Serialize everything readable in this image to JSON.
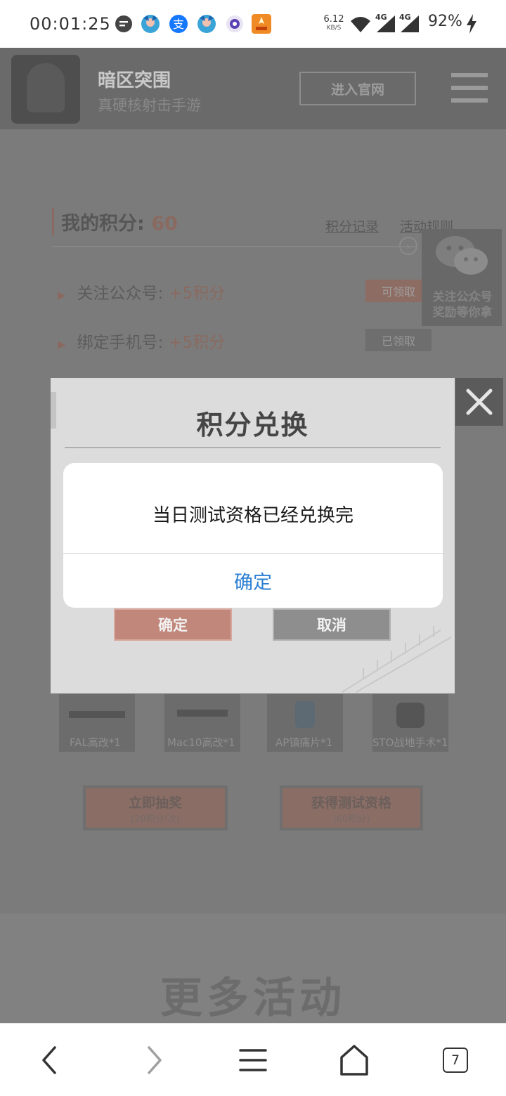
{
  "status_bar": {
    "time": "00:01:25",
    "net_speed_value": "6.12",
    "net_speed_unit": "KB/S",
    "signal_1": "4G",
    "signal_2": "4G",
    "battery": "92%"
  },
  "header": {
    "game_title": "暗区突围",
    "game_subtitle": "真硬核射击手游",
    "official_site_label": "进入官网"
  },
  "points": {
    "label": "我的积分:",
    "value": "60",
    "record_link": "积分记录",
    "rules_link": "活动规则"
  },
  "tasks": [
    {
      "label": "关注公众号:",
      "reward": "+5积分",
      "button": "可领取"
    },
    {
      "label": "绑定手机号:",
      "reward": "+5积分",
      "button": "已领取"
    }
  ],
  "wechat_float": {
    "line1": "关注公众号",
    "line2": "奖励等你拿"
  },
  "prizes": [
    {
      "label": "FAL高改*1"
    },
    {
      "label": "Mac10高改*1"
    },
    {
      "label": "AP镇痛片*1"
    },
    {
      "label": "STO战地手术*1"
    }
  ],
  "actions": {
    "draw": {
      "title": "立即抽奖",
      "sub": "(20积分/次)"
    },
    "qualify": {
      "title": "获得测试资格",
      "sub": "(60积分)"
    }
  },
  "more_activities": "更多活动",
  "modal": {
    "title": "积分兑换",
    "ok_label": "确定",
    "cancel_label": "取消"
  },
  "alert": {
    "message": "当日测试资格已经兑换完",
    "confirm_label": "确定"
  },
  "browser_nav": {
    "tab_count": "7"
  },
  "colors": {
    "alert_button": "#2b7fd3",
    "accent": "#c1877b"
  }
}
